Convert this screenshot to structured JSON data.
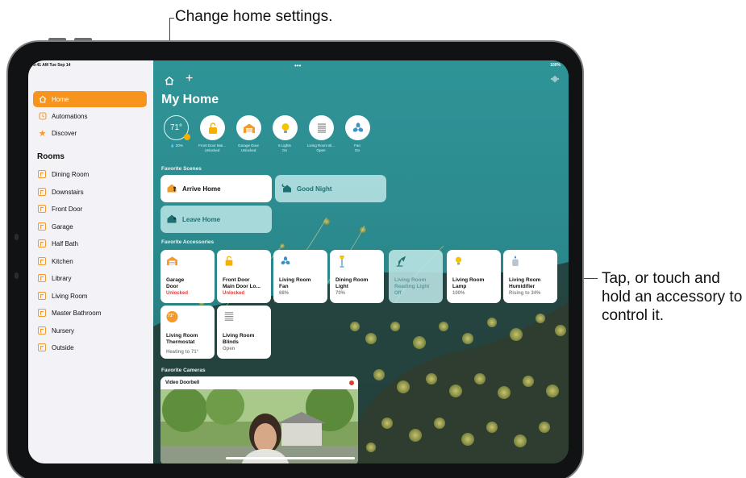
{
  "callouts": {
    "top": "Change home settings.",
    "right": "Tap, or touch and hold an accessory to control it."
  },
  "status_bar": {
    "time_date": "9:41 AM  Tue Sep 14",
    "dots": "•••",
    "battery": "100%"
  },
  "sidebar": {
    "items": [
      {
        "label": "Home",
        "icon": "house-icon",
        "active": true
      },
      {
        "label": "Automations",
        "icon": "clock-icon"
      },
      {
        "label": "Discover",
        "icon": "star-icon"
      }
    ],
    "rooms_heading": "Rooms",
    "rooms": [
      "Dining Room",
      "Downstairs",
      "Front Door",
      "Garage",
      "Half Bath",
      "Kitchen",
      "Library",
      "Living Room",
      "Master Bathroom",
      "Nursery",
      "Outside"
    ]
  },
  "main": {
    "title": "My Home",
    "status_items": [
      {
        "value": "71°",
        "label": "💧 20%"
      },
      {
        "icon": "lock-open-icon",
        "label": "Front Door Mai...\nUnlocked"
      },
      {
        "icon": "garage-icon",
        "label": "Garage Door\nUnlocked"
      },
      {
        "icon": "bulb-icon",
        "label": "6 Lights\nOn"
      },
      {
        "icon": "blinds-icon",
        "label": "Living Room Bl...\nOpen"
      },
      {
        "icon": "fan-icon",
        "label": "Fan\nOn"
      }
    ],
    "scenes_label": "Favorite Scenes",
    "scenes": [
      {
        "label": "Arrive Home",
        "on": true
      },
      {
        "label": "Good Night",
        "on": false
      },
      {
        "label": "Leave Home",
        "on": false
      }
    ],
    "accessories_label": "Favorite Accessories",
    "accessories": [
      {
        "name": "Garage\nDoor",
        "state": "Unlocked",
        "alert": true,
        "on": true,
        "icon": "garage-icon"
      },
      {
        "name": "Front Door\nMain Door Lo...",
        "state": "Unlocked",
        "alert": true,
        "on": true,
        "icon": "lock-open-icon"
      },
      {
        "name": "Living Room\nFan",
        "state": "68%",
        "on": true,
        "icon": "fan-icon"
      },
      {
        "name": "Dining Room\nLight",
        "state": "70%",
        "on": true,
        "icon": "floor-lamp-icon"
      },
      {
        "name": "Living Room\nReading Light",
        "state": "Off",
        "on": false,
        "icon": "desk-lamp-icon"
      },
      {
        "name": "Living Room\nLamp",
        "state": "100%",
        "on": true,
        "icon": "bulb-icon"
      },
      {
        "name": "Living Room\nHumidifier",
        "state": "Rising to 34%",
        "on": true,
        "icon": "humidifier-icon"
      },
      {
        "name": "Living Room\nThermostat",
        "state": "Heating to 71°",
        "on": true,
        "icon": "thermostat-icon",
        "badge": "71°"
      },
      {
        "name": "Living Room\nBlinds",
        "state": "Open",
        "on": true,
        "icon": "blinds-icon"
      }
    ],
    "cameras_label": "Favorite Cameras",
    "camera": {
      "title": "Video Doorbell"
    }
  },
  "colors": {
    "accent": "#f7941d",
    "wallpaper": "#2e8b8f",
    "alert": "#e53935"
  }
}
